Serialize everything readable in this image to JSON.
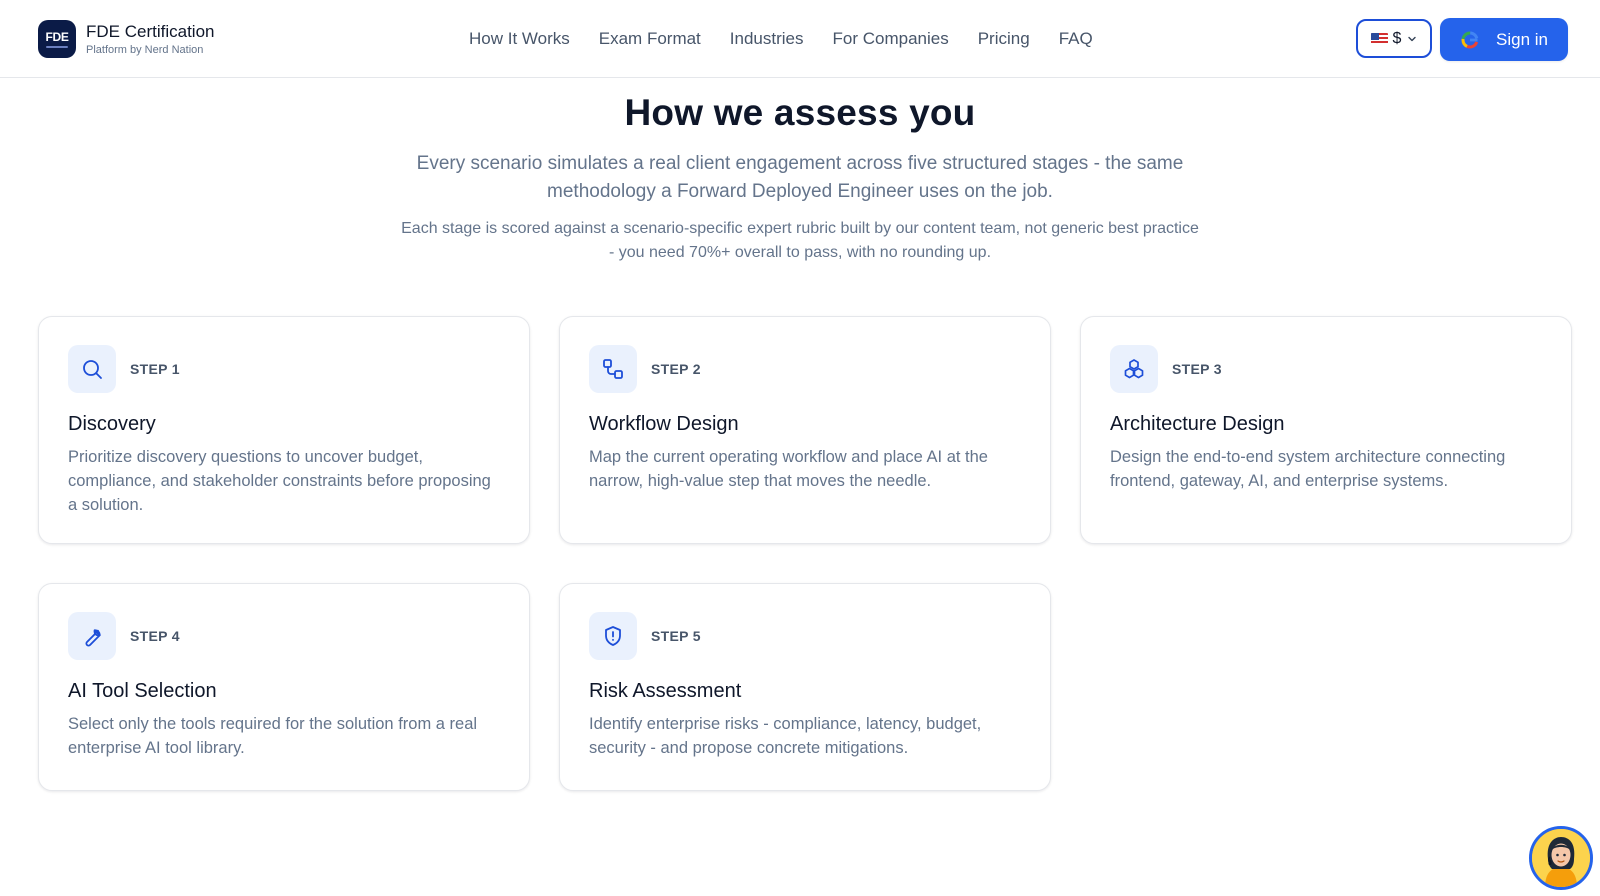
{
  "brand": {
    "logo_text": "FDE",
    "title": "FDE Certification",
    "subtitle": "Platform by Nerd Nation"
  },
  "nav": [
    "How It Works",
    "Exam Format",
    "Industries",
    "For Companies",
    "Pricing",
    "FAQ"
  ],
  "currency": {
    "flag": "us-flag-icon",
    "symbol": "$"
  },
  "signin": {
    "label": "Sign in",
    "icon": "google-icon"
  },
  "hero": {
    "title": "How we assess you",
    "lead": "Every scenario simulates a real client engagement across five structured stages - the same methodology a Forward Deployed Engineer uses on the job.",
    "note": "Each stage is scored against a scenario-specific expert rubric built by our content team, not generic best practice - you need 70%+ overall to pass, with no rounding up."
  },
  "steps": [
    {
      "step": "STEP 1",
      "title": "Discovery",
      "icon": "search-icon",
      "desc": "Prioritize discovery questions to uncover budget, compliance, and stakeholder constraints before proposing a solution."
    },
    {
      "step": "STEP 2",
      "title": "Workflow Design",
      "icon": "workflow-icon",
      "desc": "Map the current operating workflow and place AI at the narrow, high-value step that moves the needle."
    },
    {
      "step": "STEP 3",
      "title": "Architecture Design",
      "icon": "boxes-icon",
      "desc": "Design the end-to-end system architecture connecting frontend, gateway, AI, and enterprise systems."
    },
    {
      "step": "STEP 4",
      "title": "AI Tool Selection",
      "icon": "wrench-icon",
      "desc": "Select only the tools required for the solution from a real enterprise AI tool library."
    },
    {
      "step": "STEP 5",
      "title": "Risk Assessment",
      "icon": "shield-alert-icon",
      "desc": "Identify enterprise risks - compliance, latency, budget, security - and propose concrete mitigations."
    }
  ],
  "colors": {
    "accent": "#2563eb",
    "logo_bg": "#0b1b47",
    "icon_bg": "#eaf1fd",
    "muted_text": "#64748b"
  }
}
